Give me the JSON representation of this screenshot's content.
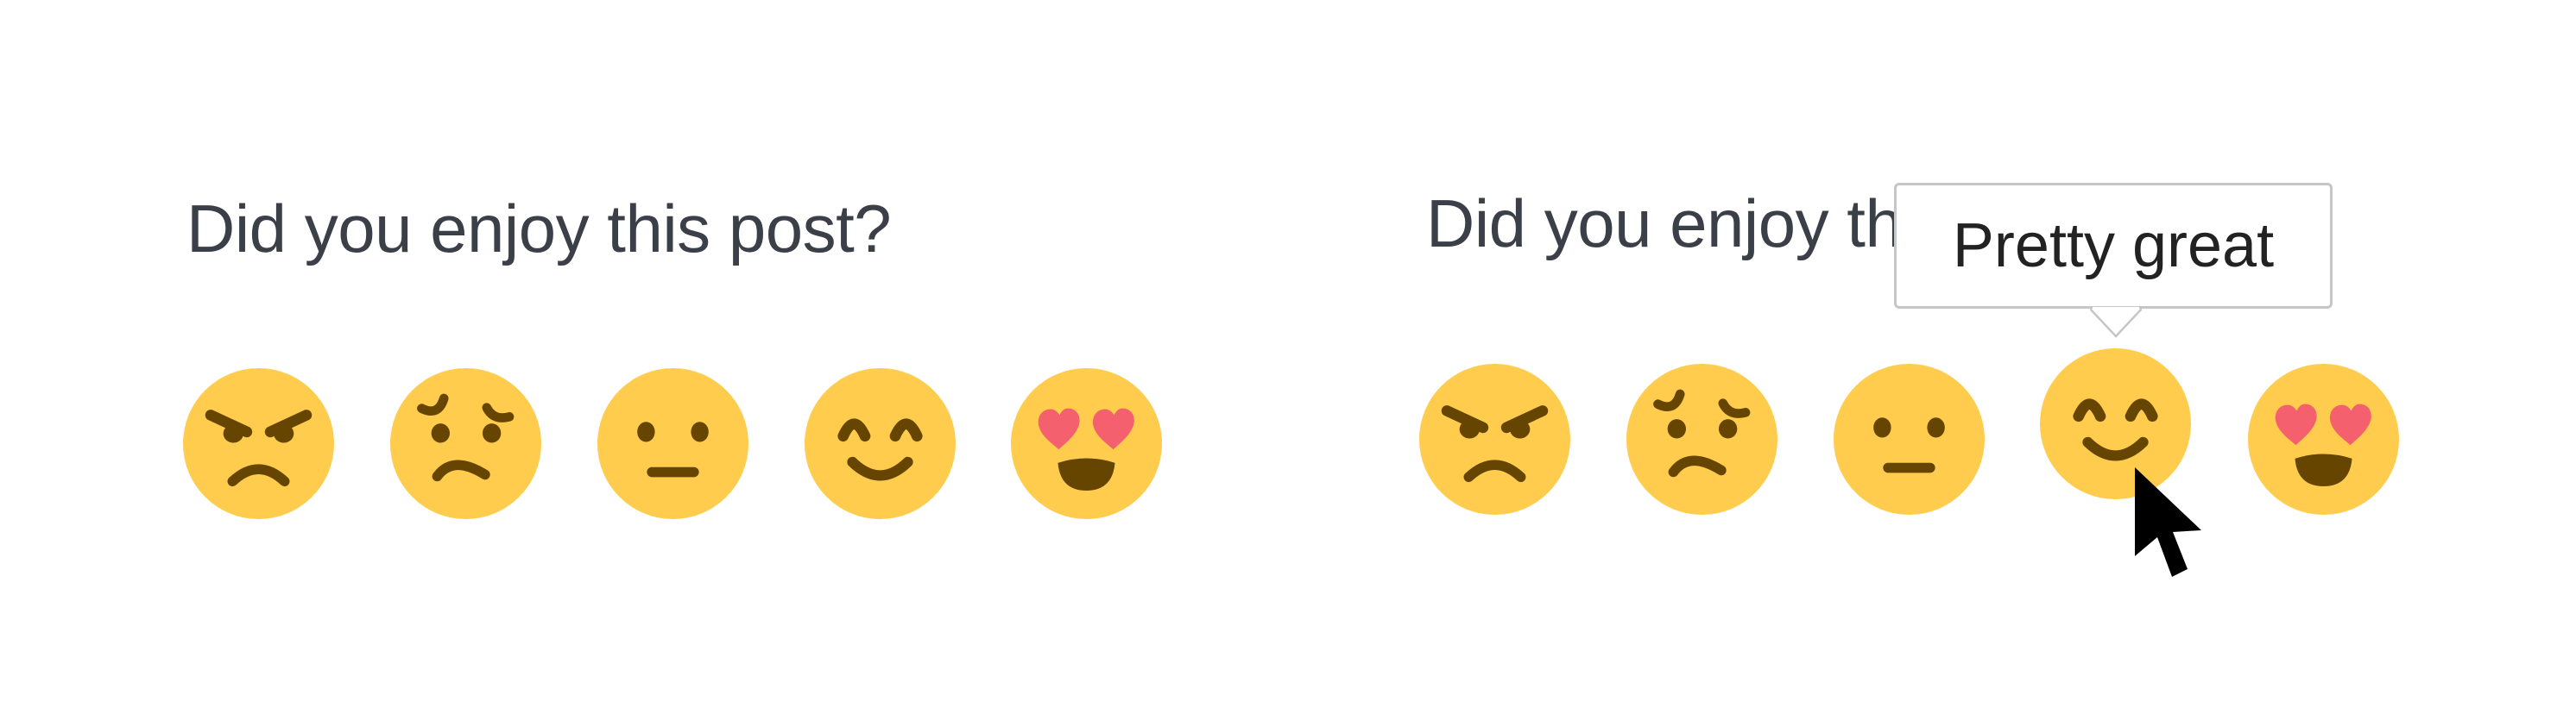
{
  "colors": {
    "background": "#ffffff",
    "heading_text": "#3b4048",
    "emoji_face": "#FFCC4D",
    "emoji_features": "#664500",
    "heart": "#F4606E",
    "tooltip_border": "#c6c6c6",
    "tooltip_text": "#222222",
    "cursor": "#000000"
  },
  "panels": [
    {
      "state": "default",
      "question": "Did you enjoy this post?",
      "options": [
        {
          "icon": "angry-face-icon",
          "label": "Angry"
        },
        {
          "icon": "worried-face-icon",
          "label": "Worried"
        },
        {
          "icon": "neutral-face-icon",
          "label": "Neutral"
        },
        {
          "icon": "smiling-face-icon",
          "label": "Pretty great"
        },
        {
          "icon": "heart-eyes-face-icon",
          "label": "Love it"
        }
      ]
    },
    {
      "state": "hover",
      "question": "Did you enjoy this post?",
      "hovered_index": 3,
      "tooltip": "Pretty great",
      "options": [
        {
          "icon": "angry-face-icon",
          "label": "Angry"
        },
        {
          "icon": "worried-face-icon",
          "label": "Worried"
        },
        {
          "icon": "neutral-face-icon",
          "label": "Neutral"
        },
        {
          "icon": "smiling-face-icon",
          "label": "Pretty great"
        },
        {
          "icon": "heart-eyes-face-icon",
          "label": "Love it"
        }
      ]
    }
  ],
  "cursor": {
    "icon": "arrow-cursor-icon"
  }
}
